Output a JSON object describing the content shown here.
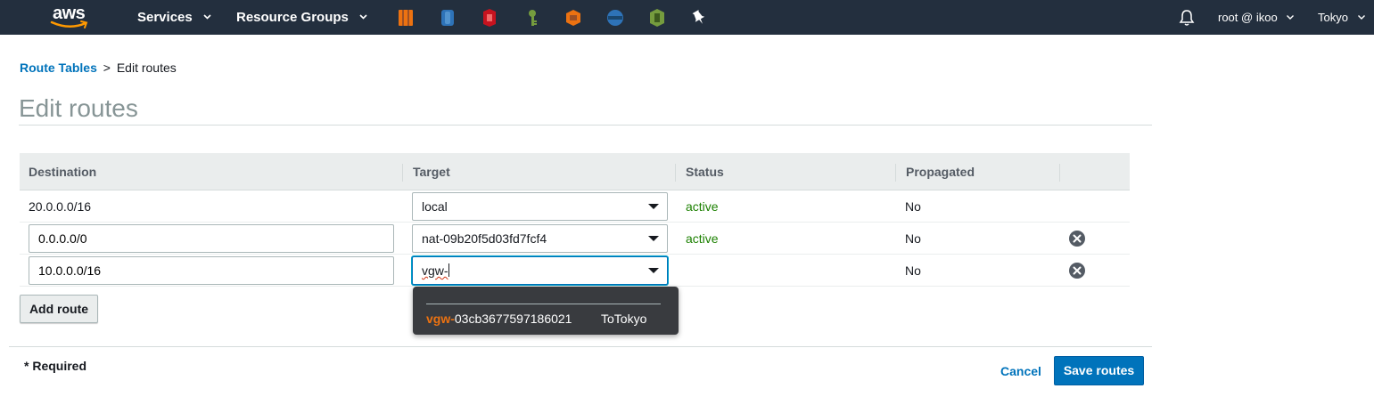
{
  "nav": {
    "logo_text": "aws",
    "services": "Services",
    "resource_groups": "Resource Groups",
    "service_icons": [
      {
        "name": "ec2-icon",
        "color": "#ec7211"
      },
      {
        "name": "dynamodb-icon",
        "color": "#2e73b8"
      },
      {
        "name": "cloudtrail-icon",
        "color": "#c7131f"
      },
      {
        "name": "kms-icon",
        "color": "#759c3e"
      },
      {
        "name": "cloudfront-icon",
        "color": "#ec7211"
      },
      {
        "name": "rds-icon",
        "color": "#2e73b8"
      },
      {
        "name": "cloudformation-icon",
        "color": "#759c3e"
      },
      {
        "name": "pin-icon",
        "color": "#ffffff"
      }
    ],
    "account": "root @ ikoo",
    "region": "Tokyo"
  },
  "breadcrumb": {
    "parent": "Route Tables",
    "separator": ">",
    "current": "Edit routes"
  },
  "page_title": "Edit routes",
  "table": {
    "headers": {
      "destination": "Destination",
      "target": "Target",
      "status": "Status",
      "propagated": "Propagated"
    },
    "rows": [
      {
        "destination": "20.0.0.0/16",
        "target": "local",
        "status": "active",
        "propagated": "No"
      },
      {
        "destination": "0.0.0.0/0",
        "target": "nat-09b20f5d03fd7fcf4",
        "status": "active",
        "propagated": "No"
      },
      {
        "destination": "10.0.0.0/16",
        "target": "vgw-",
        "status": "",
        "propagated": "No"
      }
    ]
  },
  "dropdown": {
    "option_highlight": "vgw-",
    "option_id_rest": "03cb3677597186021",
    "option_name": "ToTokyo"
  },
  "buttons": {
    "add_route": "Add route",
    "cancel": "Cancel",
    "save": "Save routes"
  },
  "required_note": "* Required",
  "colors": {
    "nav_bg": "#232f3e",
    "link": "#0073bb",
    "active": "#1d8102",
    "primary": "#0073bb",
    "highlight": "#ec7211"
  }
}
